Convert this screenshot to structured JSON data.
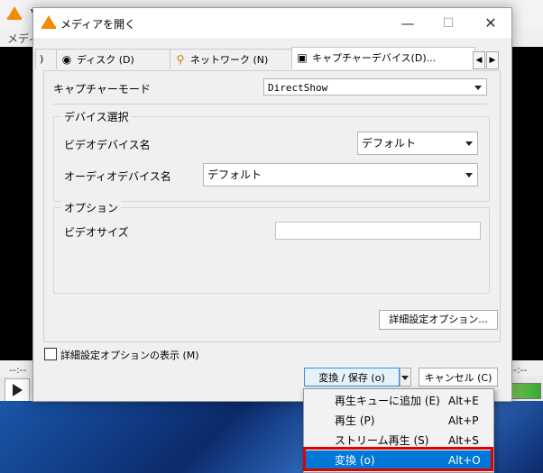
{
  "vlc": {
    "title_fragment": "V",
    "menu_fragment": "メディ",
    "seek_left": "--:--",
    "seek_right": "--:--"
  },
  "dialog": {
    "title": "メディアを開く",
    "minimize": "—",
    "maximize": "☐",
    "close": "✕"
  },
  "tabs": [
    {
      "label": ")",
      "icon": "file-tab-fragment",
      "active": false
    },
    {
      "label": "ディスク (D)",
      "icon": "disc-icon",
      "active": false
    },
    {
      "label": "ネットワーク (N)",
      "icon": "network-icon",
      "active": false
    },
    {
      "label": "キャプチャーデバイス(D)...",
      "icon": "capture-device-icon",
      "active": true
    }
  ],
  "capture": {
    "mode_label": "キャプチャーモード",
    "mode_value": "DirectShow"
  },
  "device_group": {
    "title": "デバイス選択",
    "video_label": "ビデオデバイス名",
    "video_value": "デフォルト",
    "audio_label": "オーディオデバイス名",
    "audio_value": "デフォルト"
  },
  "options_group": {
    "title": "オプション",
    "video_size_label": "ビデオサイズ",
    "video_size_value": ""
  },
  "advanced_button": "詳細設定オプション...",
  "show_advanced": {
    "label": "詳細設定オプションの表示 (M)",
    "checked": false
  },
  "buttons": {
    "convert_save": "変換 / 保存 (o)",
    "cancel": "キャンセル (C)"
  },
  "convert_menu": [
    {
      "label": "再生キューに追加 (E)",
      "shortcut": "Alt+E",
      "selected": false
    },
    {
      "label": "再生 (P)",
      "shortcut": "Alt+P",
      "selected": false
    },
    {
      "label": "ストリーム再生 (S)",
      "shortcut": "Alt+S",
      "selected": false
    },
    {
      "label": "変換 (o)",
      "shortcut": "Alt+O",
      "selected": true
    }
  ],
  "colors": {
    "selected_bg": "#0078d7",
    "highlight_box": "#e00000",
    "vlc_orange": "#f28b00"
  }
}
